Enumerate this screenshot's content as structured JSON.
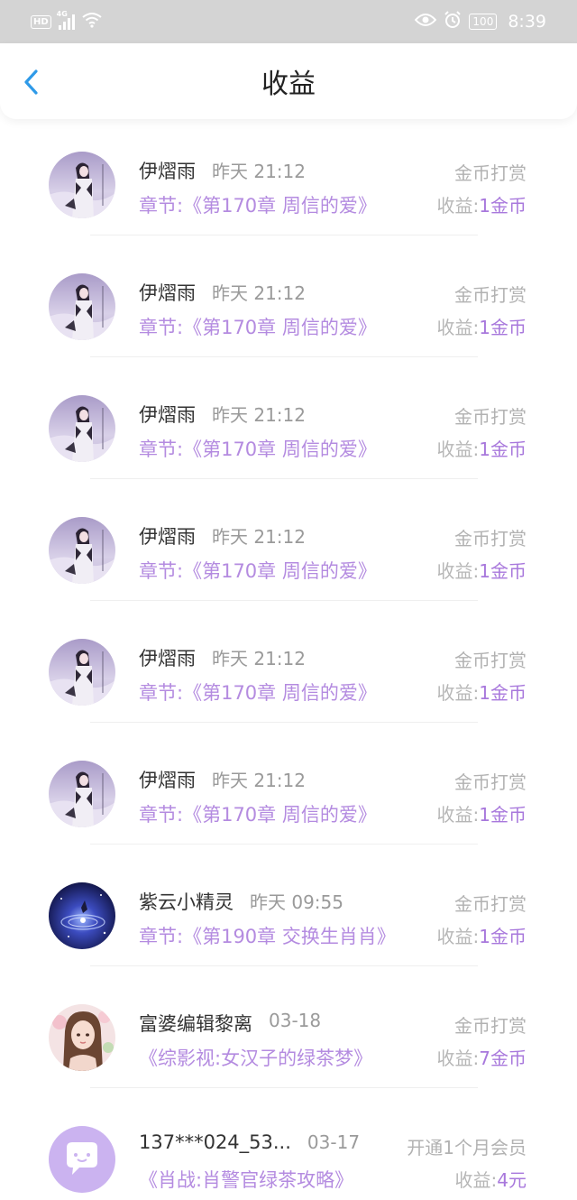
{
  "status_bar": {
    "hd": "HD",
    "network": "4G",
    "battery": "100",
    "time": "8:39"
  },
  "header": {
    "title": "收益",
    "back_icon": "chevron-left-icon",
    "accent_color": "#2f9ae8"
  },
  "colors": {
    "purple": "#b48be0",
    "gray_text": "#9a9a9a"
  },
  "items": [
    {
      "name": "伊熠雨",
      "time": "昨天 21:12",
      "type": "金币打赏",
      "chapter_label": "章节:",
      "chapter": "《第170章 周信的爱》",
      "income_label": "收益:",
      "income": "1金币",
      "avatar": "girl-avatar"
    },
    {
      "name": "伊熠雨",
      "time": "昨天 21:12",
      "type": "金币打赏",
      "chapter_label": "章节:",
      "chapter": "《第170章 周信的爱》",
      "income_label": "收益:",
      "income": "1金币",
      "avatar": "girl-avatar"
    },
    {
      "name": "伊熠雨",
      "time": "昨天 21:12",
      "type": "金币打赏",
      "chapter_label": "章节:",
      "chapter": "《第170章 周信的爱》",
      "income_label": "收益:",
      "income": "1金币",
      "avatar": "girl-avatar"
    },
    {
      "name": "伊熠雨",
      "time": "昨天 21:12",
      "type": "金币打赏",
      "chapter_label": "章节:",
      "chapter": "《第170章 周信的爱》",
      "income_label": "收益:",
      "income": "1金币",
      "avatar": "girl-avatar"
    },
    {
      "name": "伊熠雨",
      "time": "昨天 21:12",
      "type": "金币打赏",
      "chapter_label": "章节:",
      "chapter": "《第170章 周信的爱》",
      "income_label": "收益:",
      "income": "1金币",
      "avatar": "girl-avatar"
    },
    {
      "name": "伊熠雨",
      "time": "昨天 21:12",
      "type": "金币打赏",
      "chapter_label": "章节:",
      "chapter": "《第170章 周信的爱》",
      "income_label": "收益:",
      "income": "1金币",
      "avatar": "girl-avatar"
    },
    {
      "name": "紫云小精灵",
      "time": "昨天 09:55",
      "type": "金币打赏",
      "chapter_label": "章节:",
      "chapter": "《第190章 交换生肖肖》",
      "income_label": "收益:",
      "income": "1金币",
      "avatar": "galaxy-avatar"
    },
    {
      "name": "富婆编辑黎离",
      "time": "03-18",
      "type": "金币打赏",
      "chapter_label": "",
      "chapter": "《综影视:女汉子的绿茶梦》",
      "income_label": "收益:",
      "income": "7金币",
      "avatar": "woman-avatar"
    },
    {
      "name": "137***024_53...",
      "time": "03-17",
      "type": "开通1个月会员",
      "chapter_label": "",
      "chapter": "《肖战:肖警官绿茶攻略》",
      "income_label": "收益:",
      "income": "4元",
      "avatar": "chat-bubble-avatar"
    }
  ]
}
